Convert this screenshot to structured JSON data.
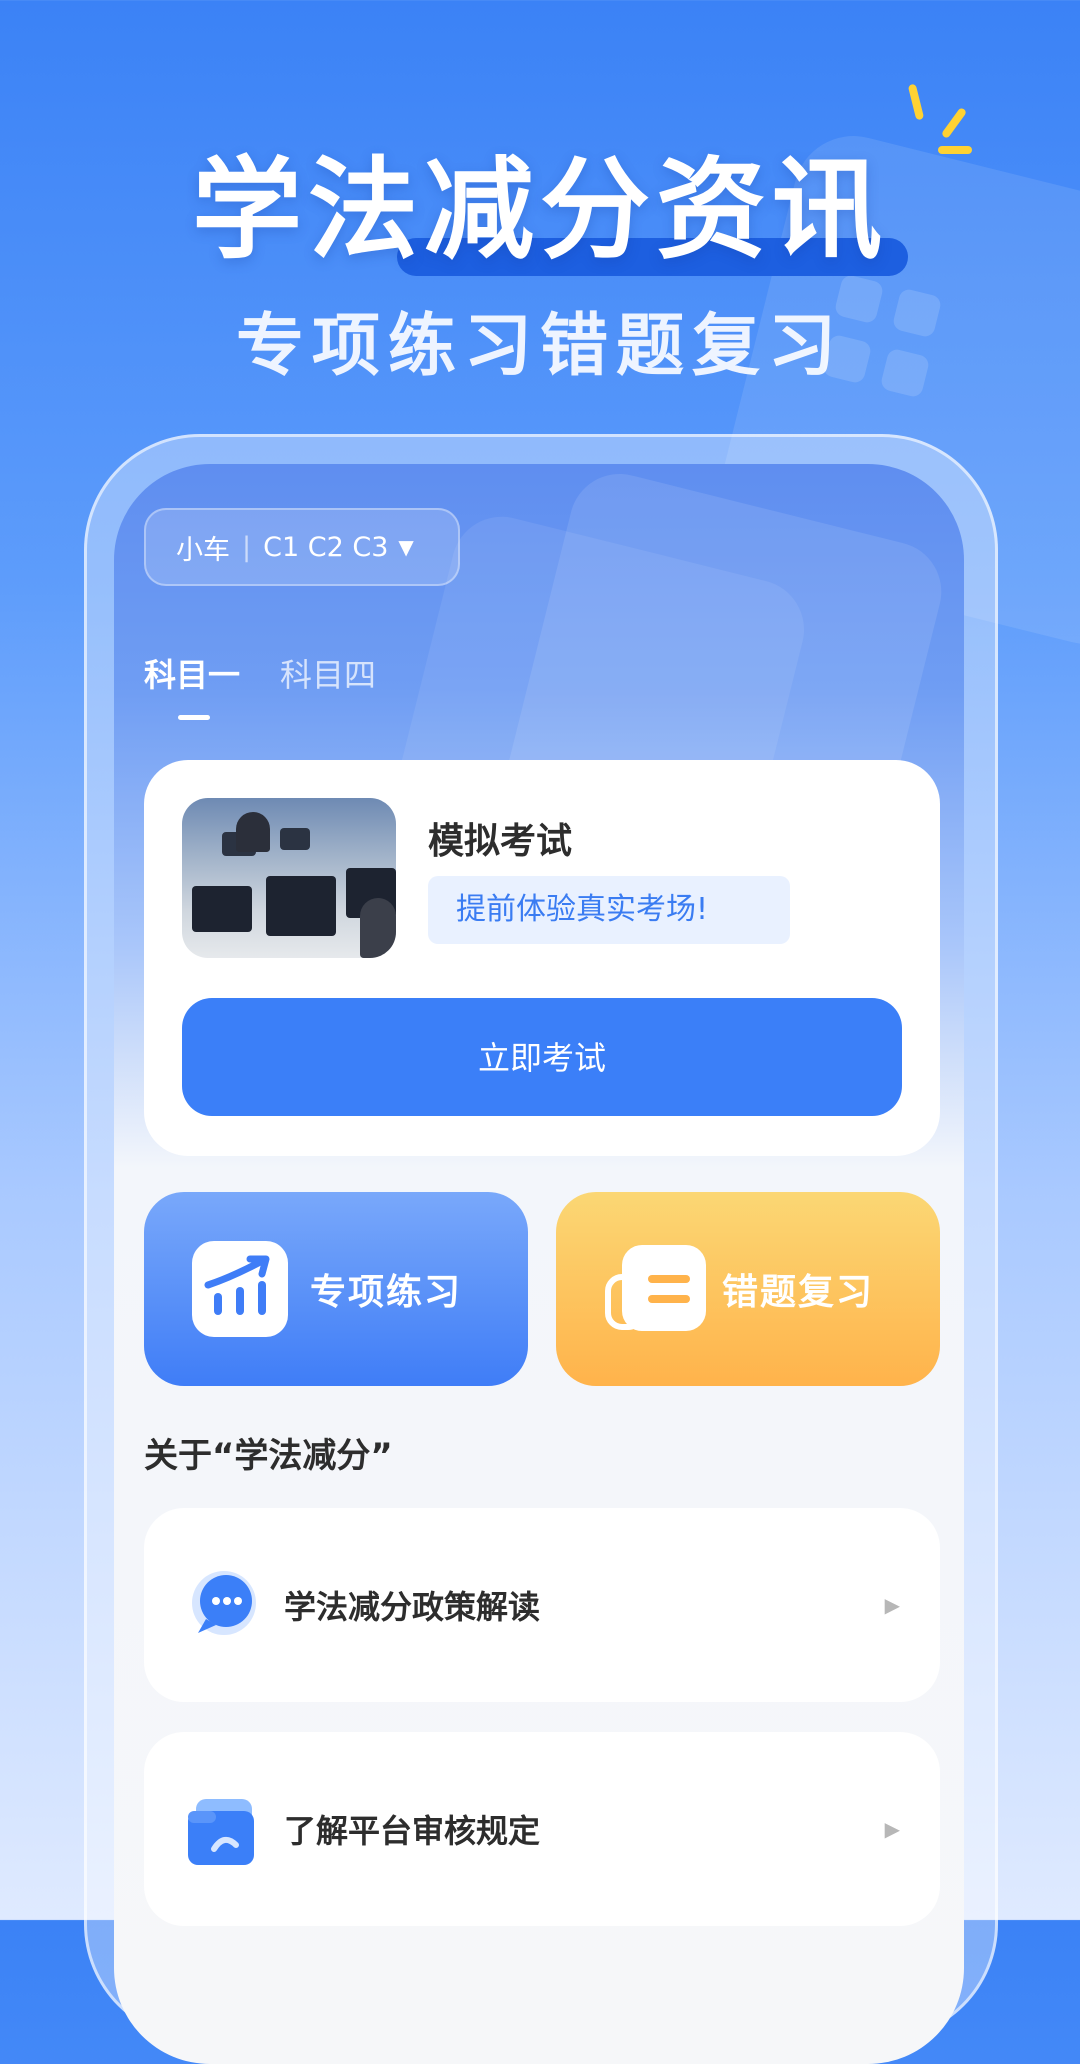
{
  "headline": {
    "title": "学法减分资讯",
    "subtitle": "专项练习错题复习"
  },
  "vehicle_selector": {
    "type": "小车",
    "licenses": "C1 C2 C3",
    "caret": "▼"
  },
  "tabs": [
    {
      "label": "科目一",
      "active": true
    },
    {
      "label": "科目四",
      "active": false
    }
  ],
  "exam_card": {
    "title": "模拟考试",
    "tag": "提前体验真实考场!",
    "button": "立即考试"
  },
  "tiles": [
    {
      "label": "专项练习",
      "icon": "chart-up-icon"
    },
    {
      "label": "错题复习",
      "icon": "document-icon"
    }
  ],
  "about": {
    "title": "关于“学法减分”",
    "items": [
      {
        "label": "学法减分政策解读",
        "icon": "chat-bubble-icon",
        "arrow": "▶"
      },
      {
        "label": "了解平台审核规定",
        "icon": "folder-icon",
        "arrow": "▶"
      }
    ]
  },
  "colors": {
    "primary": "#3b7ff8",
    "orange": "#ffb34b",
    "accent_yellow": "#ffd233"
  }
}
